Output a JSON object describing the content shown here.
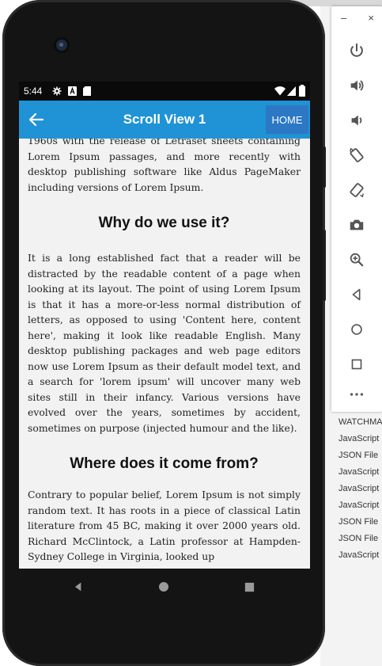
{
  "ide": {
    "list": [
      "WATCHMA",
      "JavaScript",
      "JSON File",
      "JavaScript",
      "JavaScript",
      "JavaScript",
      "JSON File",
      "JSON File",
      "JavaScript"
    ]
  },
  "emulator_toolbar": {
    "minimize": "–",
    "close": "×",
    "buttons": [
      "power-icon",
      "volume-up-icon",
      "volume-down-icon",
      "rotate-left-icon",
      "rotate-right-icon",
      "camera-icon",
      "zoom-icon",
      "back-icon",
      "home-icon",
      "overview-icon",
      "more-icon"
    ]
  },
  "status_bar": {
    "time": "5:44"
  },
  "app_bar": {
    "title": "Scroll View 1",
    "home_label": "HOME",
    "accent": "#1f93d5"
  },
  "content": {
    "intro": "1960s with the release of Letraset sheets containing Lorem Ipsum passages, and more recently with desktop publishing software like Aldus PageMaker including versions of Lorem Ipsum.",
    "heading1": "Why do we use it?",
    "para1": "It is a long established fact that a reader will be distracted by the readable content of a page when looking at its layout. The point of using Lorem Ipsum is that it has a more-or-less normal distribution of letters, as opposed to using 'Content here, content here', making it look like readable English. Many desktop publishing packages and web page editors now use Lorem Ipsum as their default model text, and a search for 'lorem ipsum' will uncover many web sites still in their infancy. Various versions have evolved over the years, sometimes by accident, sometimes on purpose (injected humour and the like).",
    "heading2": "Where does it come from?",
    "para2": "Contrary to popular belief, Lorem Ipsum is not simply random text. It has roots in a piece of classical Latin literature from 45 BC, making it over 2000 years old. Richard McClintock, a Latin professor at Hampden-Sydney College in Virginia, looked up"
  }
}
